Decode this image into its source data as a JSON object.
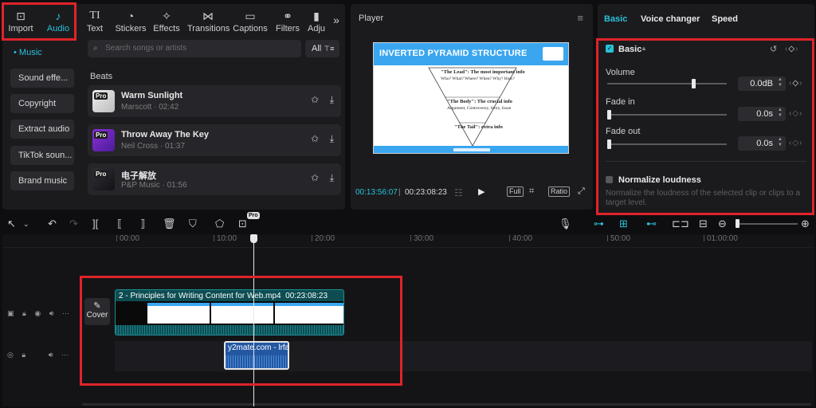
{
  "left_panel": {
    "tabs": [
      {
        "label": "Import",
        "icon": "import-icon"
      },
      {
        "label": "Audio",
        "icon": "music-note-icon"
      },
      {
        "label": "Text",
        "icon": "text-icon",
        "glyph": "TI"
      },
      {
        "label": "Stickers",
        "icon": "sticker-icon"
      },
      {
        "label": "Effects",
        "icon": "sparkle-icon"
      },
      {
        "label": "Transitions",
        "icon": "transition-icon"
      },
      {
        "label": "Captions",
        "icon": "captions-icon"
      },
      {
        "label": "Filters",
        "icon": "filter-icon"
      },
      {
        "label": "Adju",
        "icon": "adjust-icon"
      }
    ],
    "categories": [
      "Music",
      "Sound effe...",
      "Copyright",
      "Extract audio",
      "TikTok soun...",
      "Brand music"
    ],
    "search_placeholder": "Search songs or artists",
    "filter_label": "All",
    "section_title": "Beats",
    "tracks": [
      {
        "name": "Warm Sunlight",
        "sub": "Marscott · 02:42",
        "badge": "Pro"
      },
      {
        "name": "Throw Away The Key",
        "sub": "Neil Cross · 01:37",
        "badge": "Pro"
      },
      {
        "name": "电子解放",
        "sub": "P&P Music · 01:56",
        "badge": "Pro"
      }
    ]
  },
  "player": {
    "title": "Player",
    "slide": {
      "title": "INVERTED PYRAMID STRUCTURE",
      "lines": [
        {
          "text": "\"The Lead\": The most important info",
          "bold": true
        },
        {
          "text": "Who? What? Where? When? Why? How?"
        },
        {
          "text": "\"The Body\": The crucial info",
          "bold": true
        },
        {
          "text": "Argument, Controversy, Story, Issue"
        },
        {
          "text": "\"The Tail\": extra info",
          "bold": true
        }
      ]
    },
    "time_current": "00:13:56:07",
    "time_separator": "|",
    "time_total": "00:23:08:23",
    "full_label": "Full",
    "ratio_label": "Ratio"
  },
  "properties": {
    "tabs": [
      "Basic",
      "Voice changer",
      "Speed"
    ],
    "section_title": "Basic",
    "volume": {
      "label": "Volume",
      "value": "0.0dB",
      "level": 0.73
    },
    "fade_in": {
      "label": "Fade in",
      "value": "0.0s",
      "level": 0.0
    },
    "fade_out": {
      "label": "Fade out",
      "value": "0.0s",
      "level": 0.0
    },
    "normalize": {
      "label": "Normalize loudness",
      "description": "Normalize the loudness of the selected clip or clips to a target level."
    }
  },
  "toolbar": {
    "pro_label": "Pro"
  },
  "timeline": {
    "ruler": [
      "00:00",
      "10:00",
      "20:00",
      "30:00",
      "40:00",
      "50:00",
      "01:00:00"
    ],
    "cover_label": "Cover",
    "video_clip": {
      "title": "2 - Principles for Writing Content for Web.mp4",
      "duration": "00:23:08:23"
    },
    "audio_clip": {
      "title": "y2mate.com - lrfa"
    }
  },
  "colors": {
    "accent": "#29c1d9",
    "highlight": "#e0232a",
    "video_clip": "#0d4d52",
    "audio_clip": "#2357a2"
  }
}
